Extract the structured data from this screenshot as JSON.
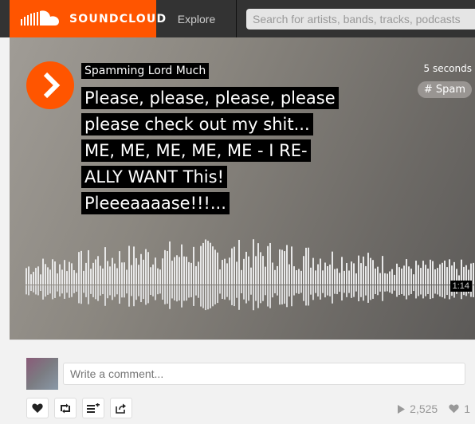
{
  "header": {
    "brand": "SOUNDCLOUD",
    "nav_explore": "Explore",
    "search_placeholder": "Search for artists, bands, tracks, podcasts",
    "accent": "#ff5500"
  },
  "track": {
    "username": "Spamming Lord Much",
    "title_lines": [
      "Please, please, please, please",
      "please check out my shit...",
      "ME, ME, ME, ME, ME - I RE-",
      "ALLY WANT This!",
      "Pleeeaaaase!!!..."
    ],
    "posted": "5 seconds",
    "tag": "# Spam",
    "duration": "1:14"
  },
  "comment": {
    "placeholder": "Write a comment..."
  },
  "actions": {
    "icons": [
      "heart-icon",
      "repost-icon",
      "add-to-playlist-icon",
      "share-icon"
    ]
  },
  "stats": {
    "plays": "2,525",
    "likes": "1"
  }
}
